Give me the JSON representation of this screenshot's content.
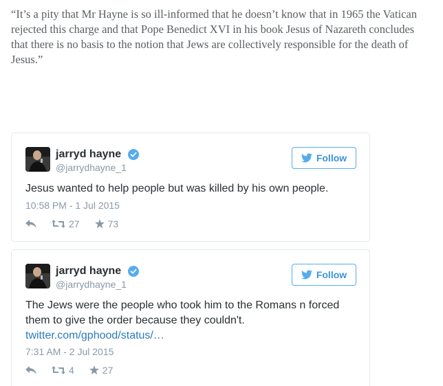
{
  "article": {
    "quote": "“It’s a pity that Mr Hayne is so ill-informed that he doesn’t know that in 1965 the Vatican rejected this charge and that Pope Benedict XVI in his book Jesus of Nazareth concludes that there is no basis to the notion that Jews are collectively responsible for the death of Jesus.”"
  },
  "tweets": [
    {
      "display_name": "jarryd hayne",
      "handle": "@jarrydhayne_1",
      "follow_label": "Follow",
      "text": "Jesus wanted to help people but was killed by his own people.",
      "link": "",
      "timestamp": "10:58 PM - 1 Jul 2015",
      "retweets": "27",
      "favorites": "73"
    },
    {
      "display_name": "jarryd hayne",
      "handle": "@jarrydhayne_1",
      "follow_label": "Follow",
      "text": "The Jews were the people who took him to the Romans n forced them to give the order because they couldn't.",
      "link": "twitter.com/gphood/status/…",
      "timestamp": "7:31 AM - 2 Jul 2015",
      "retweets": "4",
      "favorites": "27"
    }
  ],
  "colors": {
    "accent": "#55acee",
    "link": "#2b7bb9",
    "muted": "#8899a6",
    "border": "#e1e8ed"
  },
  "icons": [
    "verified-icon",
    "twitter-bird-icon",
    "reply-icon",
    "retweet-icon",
    "favorite-star-icon"
  ]
}
